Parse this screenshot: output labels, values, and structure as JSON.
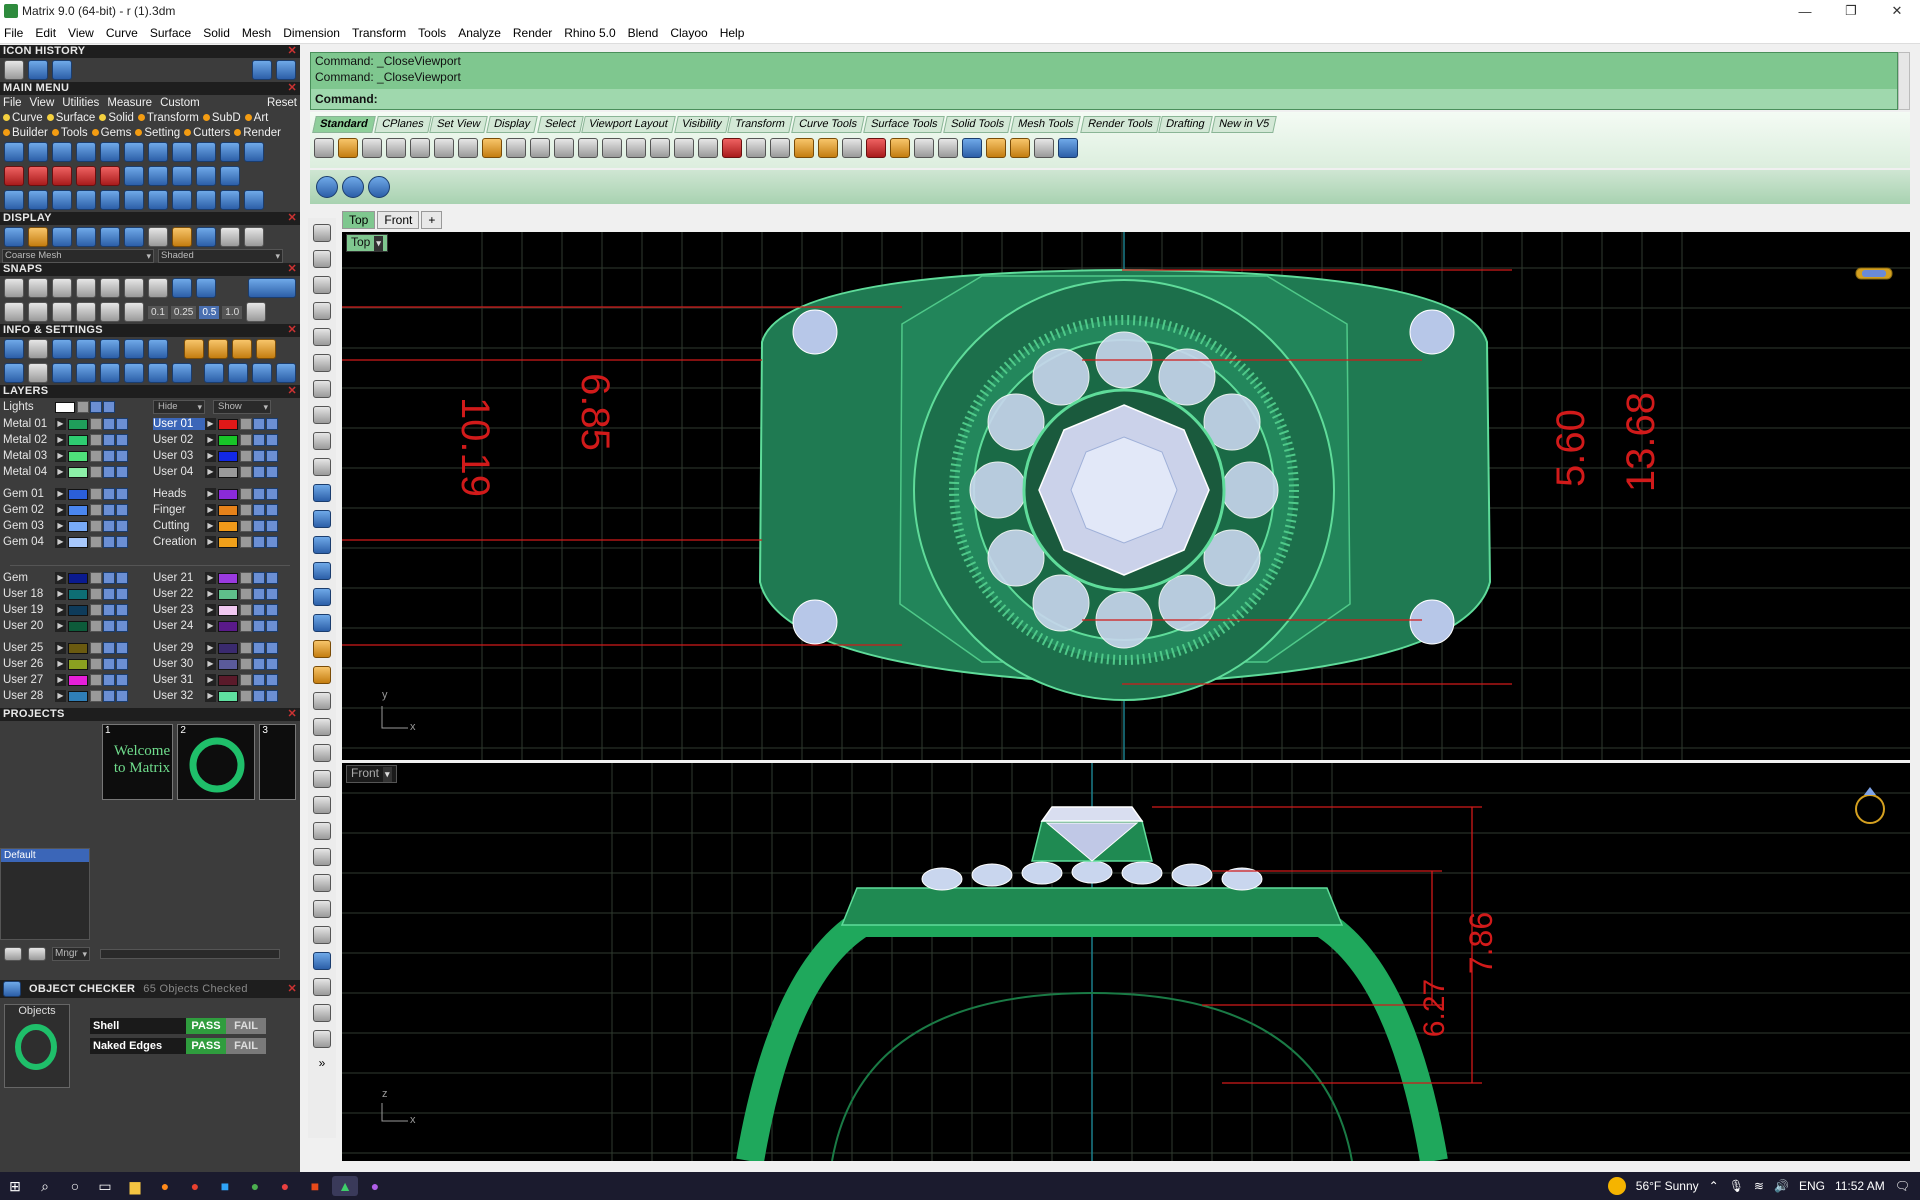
{
  "window": {
    "title": "Matrix 9.0 (64-bit) - r (1).3dm"
  },
  "menu": [
    "File",
    "Edit",
    "View",
    "Curve",
    "Surface",
    "Solid",
    "Mesh",
    "Dimension",
    "Transform",
    "Tools",
    "Analyze",
    "Render",
    "Rhino 5.0",
    "Blend",
    "Clayoo",
    "Help"
  ],
  "panels": {
    "icon_history": "ICON HISTORY",
    "main_menu": "MAIN MENU",
    "main_menu_items": [
      "File",
      "View",
      "Utilities",
      "Measure",
      "Custom",
      "Reset"
    ],
    "main_menu_cats_row1": [
      "Curve",
      "Surface",
      "Solid",
      "Transform",
      "SubD",
      "Art"
    ],
    "main_menu_cats_row2": [
      "Builder",
      "Tools",
      "Gems",
      "Setting",
      "Cutters",
      "Render"
    ],
    "display": "DISPLAY",
    "display_mesh": "Coarse Mesh",
    "display_mode": "Shaded",
    "snaps": "SNAPS",
    "snap_values": [
      "0.1",
      "0.25",
      "0.5",
      "1.0"
    ],
    "info_settings": "INFO & SETTINGS",
    "layers": "LAYERS",
    "lights": "Lights",
    "hide": "Hide",
    "show": "Show",
    "projects": "PROJECTS",
    "project_default": "Default",
    "thumb1_text": "Welcome to Matrix",
    "mngr": "Mngr",
    "object_checker": "OBJECT CHECKER",
    "objects_checked": "65 Objects Checked",
    "objects_label": "Objects",
    "checks": [
      {
        "label": "Shell",
        "pass": "PASS",
        "fail": "FAIL"
      },
      {
        "label": "Naked Edges",
        "pass": "PASS",
        "fail": "FAIL"
      }
    ]
  },
  "layers_left": [
    [
      "Metal 01",
      "#1f9e5a"
    ],
    [
      "Metal 02",
      "#2ecc71"
    ],
    [
      "Metal 03",
      "#4fe07a"
    ],
    [
      "Metal 04",
      "#8cf0a8"
    ],
    [
      "Gem 01",
      "#2b5fd9"
    ],
    [
      "Gem 02",
      "#4a86ef"
    ],
    [
      "Gem 03",
      "#78aaf7"
    ],
    [
      "Gem 04",
      "#a8c8fb"
    ],
    [
      "Gem",
      "#0a1a8f"
    ],
    [
      "User 18",
      "#0e6e74"
    ],
    [
      "User 19",
      "#0e3b5a"
    ],
    [
      "User 20",
      "#0d5b3a"
    ],
    [
      "User 25",
      "#6a5a10"
    ],
    [
      "User 26",
      "#8aa020"
    ],
    [
      "User 27",
      "#e61fd9"
    ],
    [
      "User 28",
      "#2f7fb8"
    ]
  ],
  "layers_right": [
    [
      "User 01",
      "#e01818"
    ],
    [
      "User 02",
      "#18c428"
    ],
    [
      "User 03",
      "#1228e6"
    ],
    [
      "User 04",
      "#9a9a9a"
    ],
    [
      "Heads",
      "#8a2ad9"
    ],
    [
      "Finger",
      "#e6821a"
    ],
    [
      "Cutting",
      "#f09a1a"
    ],
    [
      "Creation",
      "#f0a01a"
    ],
    [
      "User 21",
      "#9a3ae0"
    ],
    [
      "User 22",
      "#5fbf8a"
    ],
    [
      "User 23",
      "#f0c8f0"
    ],
    [
      "User 24",
      "#5a1a8a"
    ],
    [
      "User 29",
      "#3a2a6e"
    ],
    [
      "User 30",
      "#5a5a9a"
    ],
    [
      "User 31",
      "#5a1a2a"
    ],
    [
      "User 32",
      "#5fe0a0"
    ]
  ],
  "command": {
    "history": [
      "Command: _CloseViewport",
      "Command: _CloseViewport"
    ],
    "prompt": "Command:"
  },
  "toolbar_tabs": [
    "Standard",
    "CPlanes",
    "Set View",
    "Display",
    "Select",
    "Viewport Layout",
    "Visibility",
    "Transform",
    "Curve Tools",
    "Surface Tools",
    "Solid Tools",
    "Mesh Tools",
    "Render Tools",
    "Drafting",
    "New in V5"
  ],
  "viewport_tabs": [
    "Top",
    "Front"
  ],
  "viewports": {
    "top_label": "Top",
    "front_label": "Front",
    "top_axis": [
      "y",
      "x"
    ],
    "front_axis": [
      "z",
      "x"
    ],
    "dims_top": [
      "10.19",
      "6.85",
      "5.60",
      "13.68"
    ],
    "dims_front": [
      "7.86",
      "6.27"
    ]
  },
  "taskbar": {
    "weather": "56°F  Sunny",
    "lang": "ENG",
    "time": "11:52 AM"
  }
}
